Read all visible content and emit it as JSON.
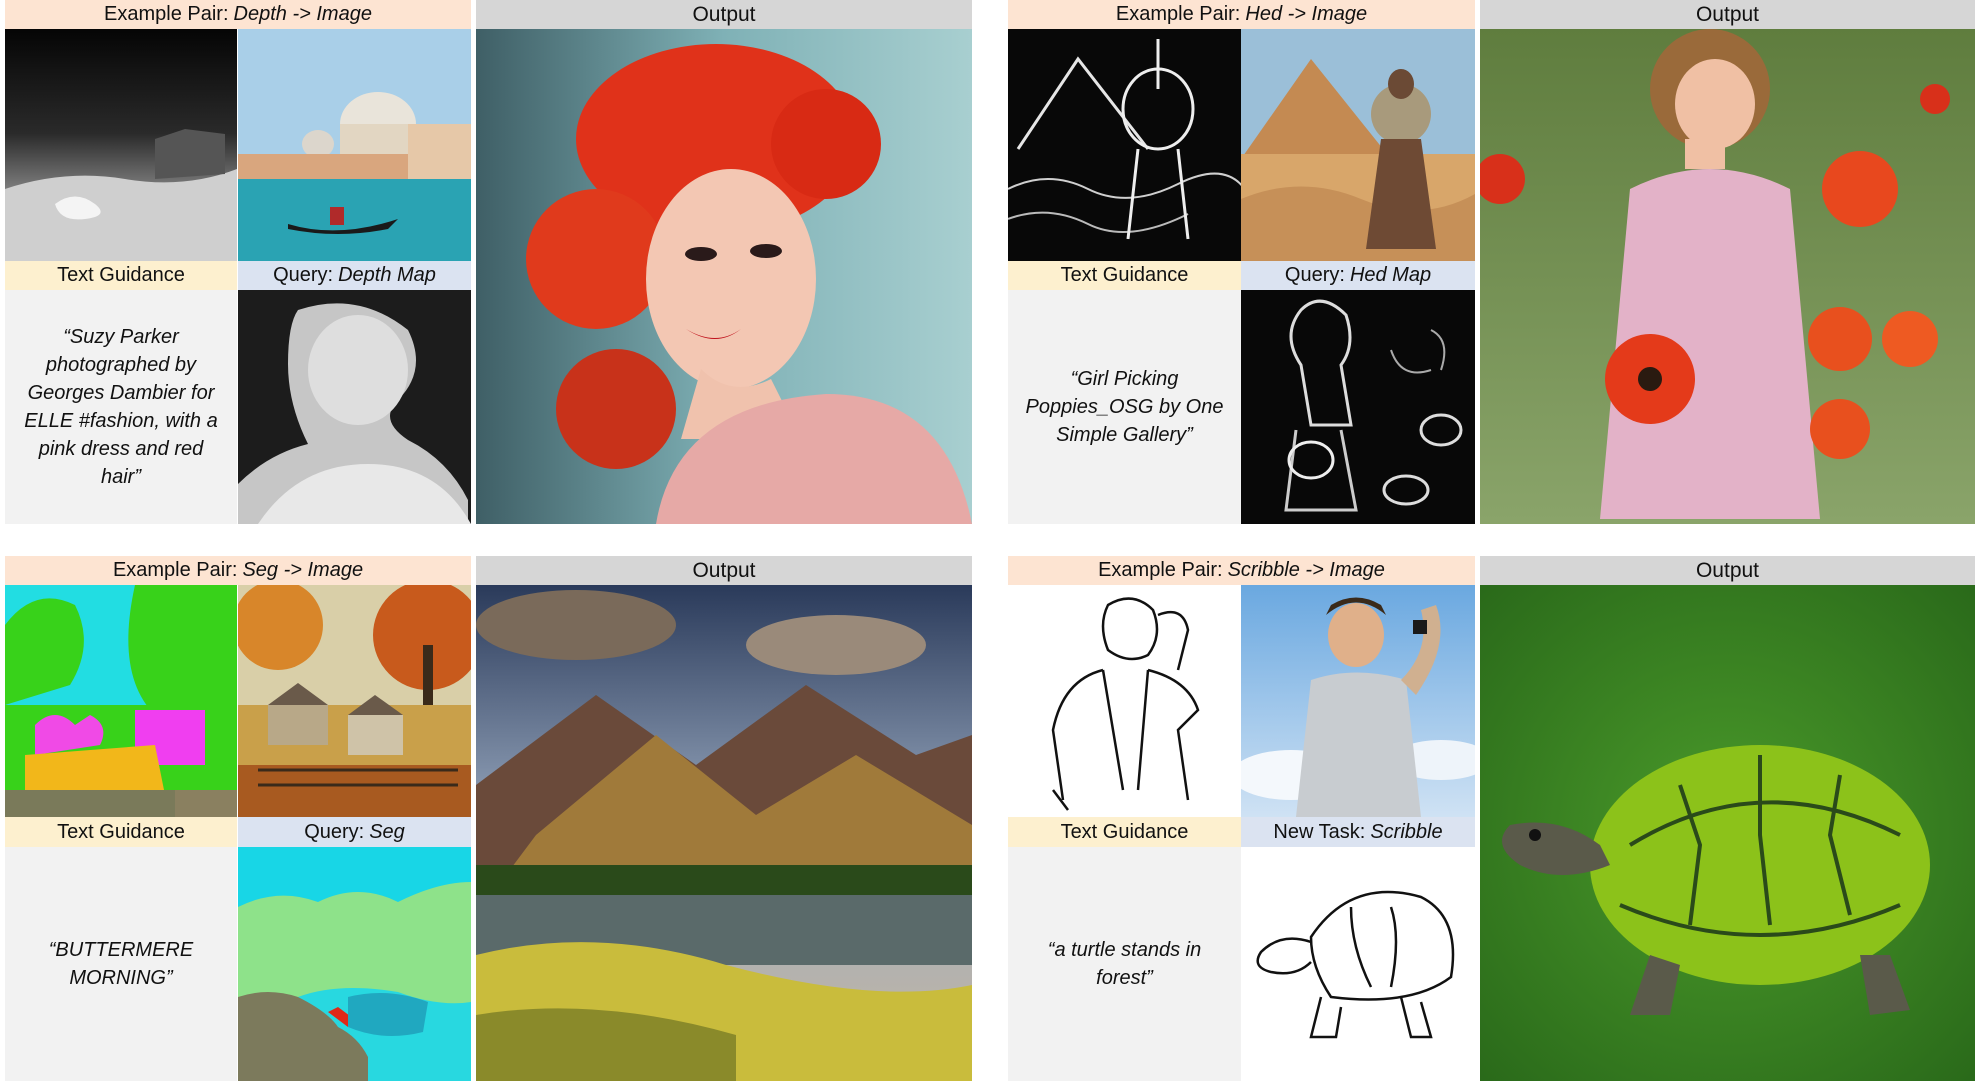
{
  "panels": [
    {
      "example_header": {
        "prefix": "Example Pair:",
        "pair": "Depth -> Image"
      },
      "output_header": "Output",
      "text_guidance_header": "Text Guidance",
      "query_header": {
        "prefix": "Query:",
        "task": "Depth Map"
      },
      "prompt": "“Suzy Parker photographed by Georges Dambier for ELLE #fashion, with a pink dress and red hair”"
    },
    {
      "example_header": {
        "prefix": "Example Pair:",
        "pair": "Hed -> Image"
      },
      "output_header": "Output",
      "text_guidance_header": "Text Guidance",
      "query_header": {
        "prefix": "Query:",
        "task": "Hed Map"
      },
      "prompt": "“Girl Picking Poppies_OSG by One Simple Gallery”"
    },
    {
      "example_header": {
        "prefix": "Example Pair:",
        "pair": "Seg -> Image"
      },
      "output_header": "Output",
      "text_guidance_header": "Text Guidance",
      "query_header": {
        "prefix": "Query:",
        "task": "Seg"
      },
      "prompt": "“BUTTERMERE MORNING”"
    },
    {
      "example_header": {
        "prefix": "Example Pair:",
        "pair": "Scribble -> Image"
      },
      "output_header": "Output",
      "text_guidance_header": "Text Guidance",
      "query_header": {
        "prefix": "New Task:",
        "task": "Scribble"
      },
      "prompt": "“a turtle stands in forest”"
    }
  ]
}
